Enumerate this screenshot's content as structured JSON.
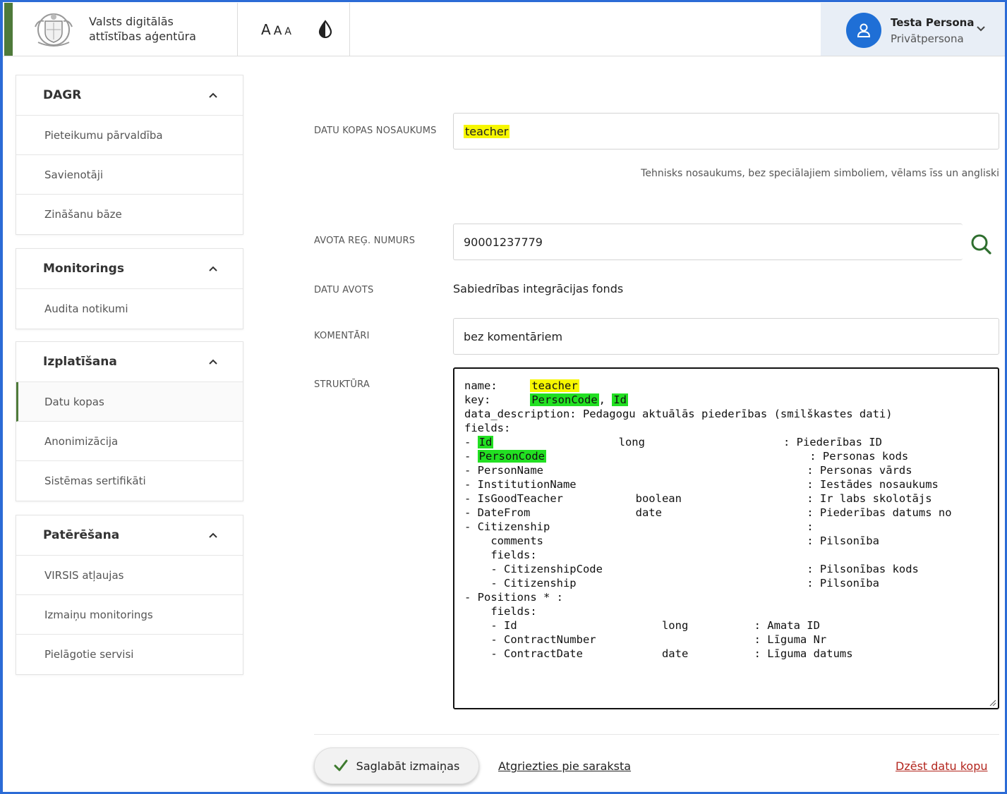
{
  "header": {
    "org_name_line1": "Valsts digitālās",
    "org_name_line2": "attīstības aģentūra",
    "font_size_options": [
      "A",
      "A",
      "A"
    ],
    "contrast_icon": "contrast-drop-icon",
    "user_name": "Testa Persona",
    "user_role": "Privātpersona"
  },
  "sidebar": [
    {
      "title": "DAGR",
      "items": [
        "Pieteikumu pārvaldība",
        "Savienotāji",
        "Zināšanu bāze"
      ]
    },
    {
      "title": "Monitorings",
      "items": [
        "Audita notikumi"
      ]
    },
    {
      "title": "Izplatīšana",
      "items": [
        "Datu kopas",
        "Anonimizācija",
        "Sistēmas sertifikāti"
      ],
      "active": "Datu kopas"
    },
    {
      "title": "Patērēšana",
      "items": [
        "VIRSIS atļaujas",
        "Izmaiņu monitorings",
        "Pielāgotie servisi"
      ]
    }
  ],
  "form": {
    "name_label": "DATU KOPAS NOSAUKUMS",
    "name_value": "teacher",
    "name_hint": "Tehnisks nosaukums, bez speciālajiem simboliem, vēlams īss un angliski",
    "reg_label": "AVOTA REĢ. NUMURS",
    "reg_value": "90001237779",
    "source_label": "DATU AVOTS",
    "source_value": "Sabiedrības integrācijas fonds",
    "comments_label": "KOMENTĀRI",
    "comments_value": "bez komentāriem",
    "structure_label": "STRUKTŪRA",
    "structure": {
      "l1_pre": "name:     ",
      "l1_name": "teacher",
      "l2_pre": "key:      ",
      "l2_key1": "PersonCode",
      "l2_sep": ", ",
      "l2_key2": "Id",
      "l3": "data_description: Pedagogu aktuālās piederības (smilškastes dati)",
      "l4": "fields:",
      "l5_pre": "- ",
      "l5_id": "Id",
      "l5_rest": "                   long                     : Piederības ID",
      "l6_pre": "- ",
      "l6_pc": "PersonCode",
      "l6_rest": "                                        : Personas kods",
      "l7": "- PersonName                                        : Personas vārds",
      "l8": "- InstitutionName                                   : Iestādes nosaukums",
      "l9": "- IsGoodTeacher           boolean                   : Ir labs skolotājs",
      "l10": "- DateFrom                date                      : Piederības datums no",
      "l11": "- Citizenship                                       :",
      "l12": "    comments                                        : Pilsonība",
      "l13": "    fields:",
      "l14": "    - CitizenshipCode                               : Pilsonības kods",
      "l15": "    - Citizenship                                   : Pilsonība",
      "l16": "- Positions * :",
      "l17": "    fields:",
      "l18": "    - Id                      long          : Amata ID",
      "l19": "    - ContractNumber                        : Līguma Nr",
      "l20": "    - ContractDate            date          : Līguma datums"
    }
  },
  "actions": {
    "save_label": "Saglabāt izmaiņas",
    "back_label": "Atgriezties pie saraksta",
    "delete_label": "Dzēst datu kopu"
  },
  "colors": {
    "accent_green": "#4e7a3a",
    "avatar_blue": "#1f6fd6",
    "highlight_yellow": "#f7f700",
    "highlight_green": "#22e022",
    "delete_red": "#b3261e"
  }
}
